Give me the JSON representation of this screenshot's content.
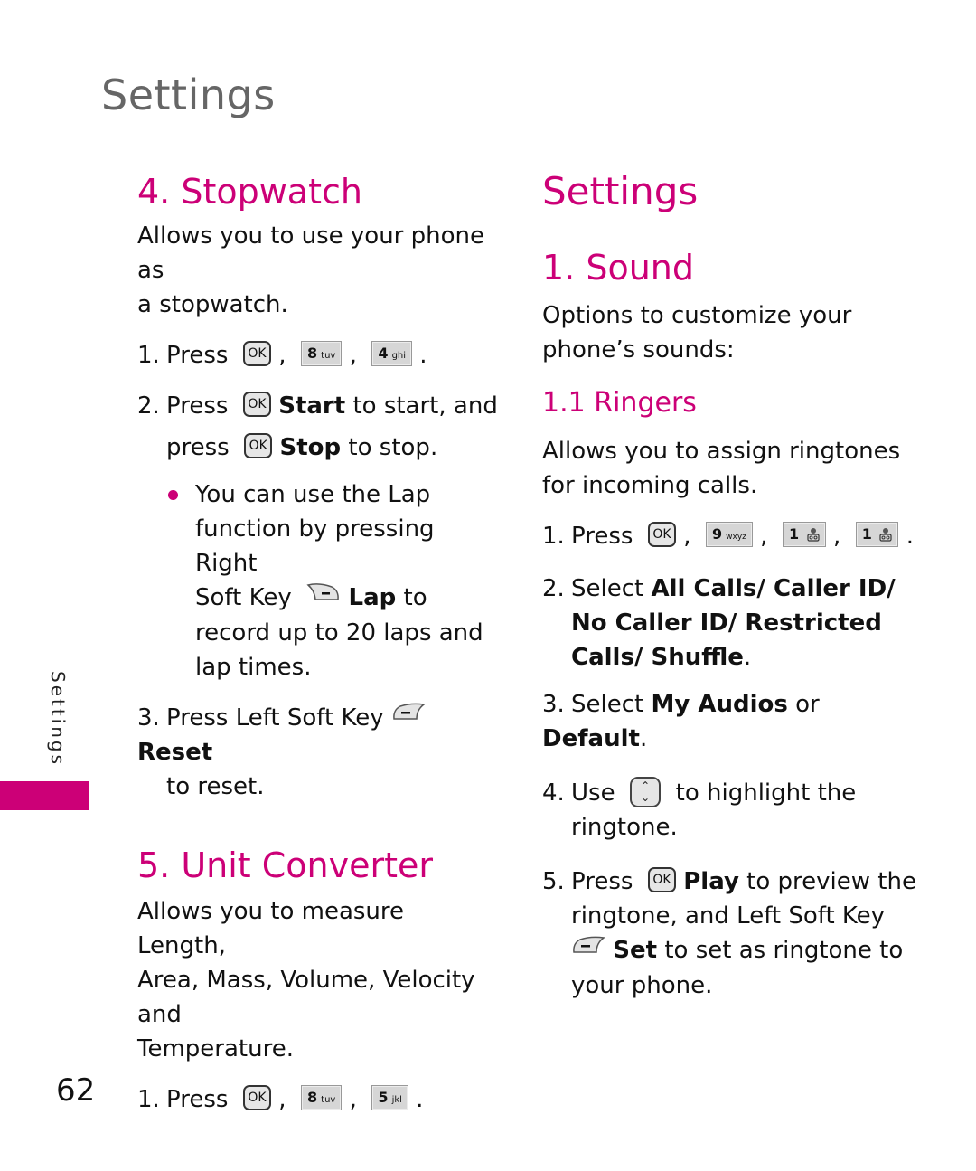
{
  "running_header": "Settings",
  "side_tab_label": "Settings",
  "page_number": "62",
  "accent_color": "#cc0077",
  "left_column": {
    "stopwatch": {
      "heading": "4. Stopwatch",
      "intro": [
        "Allows you to use your phone as",
        "a stopwatch."
      ],
      "steps": [
        {
          "num": "1.",
          "lead": "Press",
          "keys": [
            {
              "type": "ok",
              "label": "OK"
            },
            {
              "type": "num",
              "digit": "8",
              "letters": "tuv"
            },
            {
              "type": "num",
              "digit": "4",
              "letters": "ghi"
            }
          ]
        },
        {
          "num": "2.",
          "line1_lead": "Press",
          "line1_key": "OK",
          "line1_bold": "Start",
          "line1_rest": "to start, and",
          "line2_lead": "press",
          "line2_key": "OK",
          "line2_bold": "Stop",
          "line2_rest": "to stop."
        }
      ],
      "bullet": {
        "line1": "You can use the Lap",
        "line2": "function by pressing Right",
        "line3_lead": "Soft Key",
        "line3_icon": "right-soft-key-icon",
        "line3_bold": "Lap",
        "line3_rest": "to",
        "line4": "record up to 20 laps and",
        "line5": "lap times."
      },
      "step3": {
        "num": "3.",
        "lead": "Press Left Soft Key",
        "icon": "left-soft-key-icon",
        "bold": "Reset",
        "line2": "to reset."
      }
    },
    "unit_converter": {
      "heading": "5. Unit Converter",
      "intro": [
        "Allows you to measure Length,",
        "Area, Mass, Volume, Velocity and",
        "Temperature."
      ],
      "step1": {
        "num": "1.",
        "lead": "Press",
        "keys": [
          {
            "type": "ok",
            "label": "OK"
          },
          {
            "type": "num",
            "digit": "8",
            "letters": "tuv"
          },
          {
            "type": "num",
            "digit": "5",
            "letters": "jkl"
          }
        ]
      }
    }
  },
  "right_column": {
    "section_title": "Settings",
    "sound": {
      "heading": "1. Sound",
      "intro": [
        "Options to customize your",
        "phone’s sounds:"
      ]
    },
    "ringers": {
      "heading": "1.1  Ringers",
      "intro": [
        "Allows you to assign ringtones",
        "for incoming calls."
      ],
      "step1": {
        "num": "1.",
        "lead": "Press",
        "keys": [
          {
            "type": "ok",
            "label": "OK"
          },
          {
            "type": "num",
            "digit": "9",
            "letters": "wxyz"
          },
          {
            "type": "num",
            "digit": "1",
            "letters": "voicemail"
          },
          {
            "type": "num",
            "digit": "1",
            "letters": "voicemail"
          }
        ]
      },
      "step2": {
        "num": "2.",
        "lead": "Select",
        "line1_bold": "All Calls/ Caller ID/",
        "line2_bold": "No Caller ID/ Restricted",
        "line3_bold": "Calls/ Shuffle",
        "line3_end": "."
      },
      "step3": {
        "num": "3.",
        "lead": "Select",
        "bold1": "My Audios",
        "mid": "or",
        "bold2": "Default",
        "end": "."
      },
      "step4": {
        "num": "4.",
        "lead": "Use",
        "icon": "up-down-nav-key-icon",
        "rest": "to highlight the",
        "line2": "ringtone."
      },
      "step5": {
        "num": "5.",
        "lead": "Press",
        "key": "OK",
        "bold1": "Play",
        "rest1": "to preview the",
        "line2": "ringtone, and Left Soft Key",
        "line3_icon": "left-soft-key-icon",
        "line3_bold": "Set",
        "line3_rest": "to set as ringtone to",
        "line4": "your phone."
      }
    }
  }
}
